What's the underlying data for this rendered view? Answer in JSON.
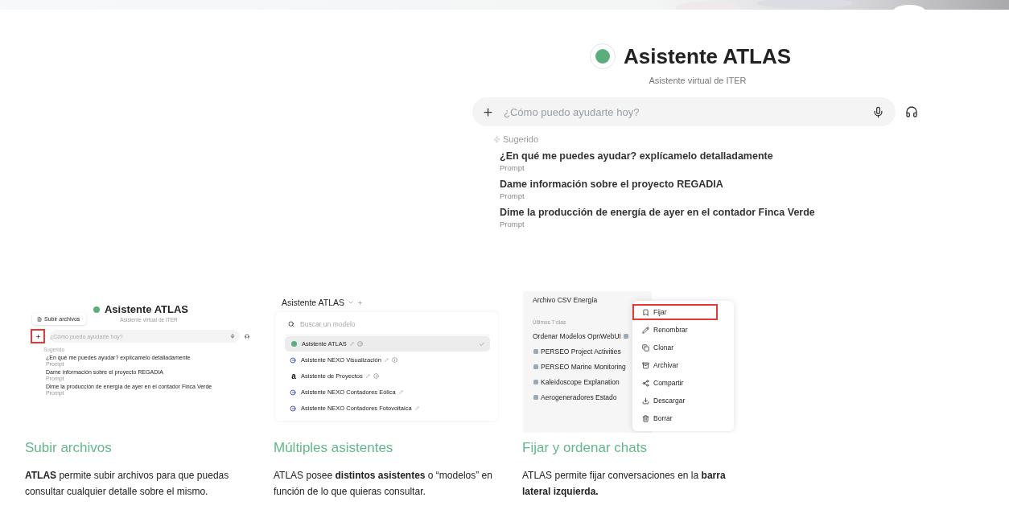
{
  "hero": {
    "title": "Asistente ATLAS",
    "subtitle": "Asistente virtual de ITER",
    "input": {
      "placeholder": "¿Cómo puedo ayudarte hoy?"
    },
    "suggested_label": "Sugerido",
    "suggestions": [
      {
        "text": "¿En qué me puedes ayudar? explícamelo detalladamente",
        "tag": "Prompt"
      },
      {
        "text": "Dame información sobre el proyecto REGADIA",
        "tag": "Prompt"
      },
      {
        "text": "Dime la producción de energía de ayer en el contador Finca Verde",
        "tag": "Prompt"
      }
    ]
  },
  "features": [
    {
      "title": "Subir archivos",
      "description": "**ATLAS** permite subir archivos para que puedas consultar cualquier detalle sobre el mismo.",
      "screenshot": {
        "kind": "chat",
        "title": "Asistente ATLAS",
        "subtitle": "Asistente virtual de ITER",
        "popup": "Subir archivos",
        "placeholder": "¿Cómo puedo ayudarte hoy?",
        "plus_highlighted": true,
        "suggested_label": "Sugerido",
        "suggestions": [
          {
            "text": "¿En qué me puedes ayudar? explícamelo detalladamente",
            "tag": "Prompt"
          },
          {
            "text": "Dame información sobre el proyecto REGADIA",
            "tag": "Prompt"
          },
          {
            "text": "Dime la producción de energía de ayer en el contador Finca Verde",
            "tag": "Prompt"
          }
        ]
      }
    },
    {
      "title": "Múltiples asistentes",
      "description": "ATLAS posee **distintos asistentes** o “modelos” en función de lo que quieras consultar.",
      "screenshot": {
        "kind": "models",
        "header": "Asistente ATLAS",
        "search_placeholder": "Buscar un modelo",
        "models": [
          {
            "name": "Asistente ATLAS",
            "kind": "dot",
            "info": true,
            "selected": true
          },
          {
            "name": "Asistente NEXO Visualización",
            "kind": "nexo",
            "info": true,
            "selected": false
          },
          {
            "name": "Asistente de Proyectos",
            "kind": "letter",
            "letter": "a",
            "info": true,
            "selected": false
          },
          {
            "name": "Asistente NEXO Contadores Eólica",
            "kind": "nexo",
            "info": false,
            "selected": false
          },
          {
            "name": "Asistente NEXO Contadores Fotovoltaica",
            "kind": "nexo",
            "info": false,
            "selected": false
          }
        ]
      }
    },
    {
      "title": "Fijar y ordenar chats",
      "description": "ATLAS permite fijar conversaciones en la **barra lateral izquierda.**",
      "screenshot": {
        "kind": "chats",
        "top_chat": "Archivo CSV Energía",
        "section": "Últimos 7 días",
        "chats": [
          {
            "name": "Ordenar Modelos OpnWebUI"
          },
          {
            "name": "PERSEO Project Activities"
          },
          {
            "name": "PERSEO Marine Monitoring"
          },
          {
            "name": "Kaleidoscope Explanation"
          },
          {
            "name": "Aerogeneradores Estado"
          }
        ],
        "menu": [
          {
            "label": "Fijar",
            "highlighted": true
          },
          {
            "label": "Renombrar",
            "highlighted": false
          },
          {
            "label": "Clonar",
            "highlighted": false
          },
          {
            "label": "Archivar",
            "highlighted": false
          },
          {
            "label": "Compartir",
            "highlighted": false
          },
          {
            "label": "Descargar",
            "highlighted": false
          },
          {
            "label": "Borrar",
            "highlighted": false
          }
        ]
      }
    }
  ]
}
